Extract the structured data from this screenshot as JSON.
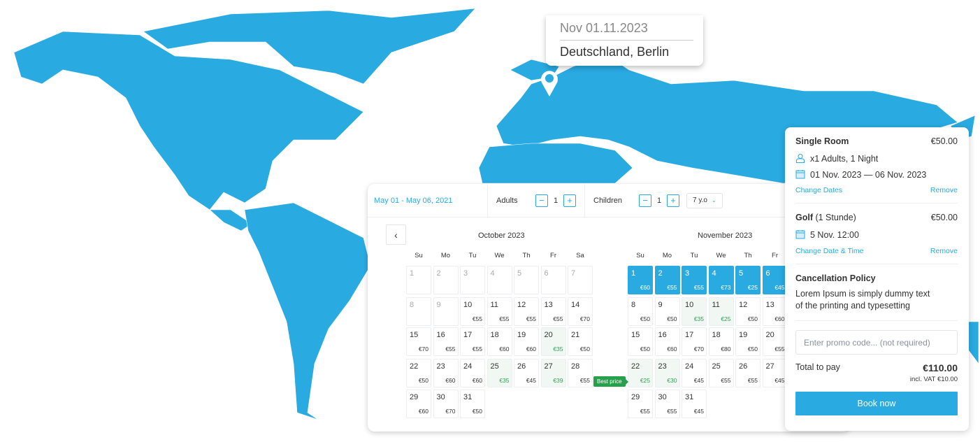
{
  "colors": {
    "accent": "#29abe2",
    "map": "#29abe2",
    "best": "#27a04c"
  },
  "tooltip": {
    "date": "Nov 01.11.2023",
    "place": "Deutschland, Berlin",
    "icon": "map-pin-icon"
  },
  "toolbar": {
    "range": "May 01 - May 06, 2021",
    "adults_label": "Adults",
    "adults": "1",
    "children_label": "Children",
    "children": "1",
    "age": "7 y.o",
    "minus": "−",
    "plus": "+"
  },
  "calendar": {
    "weekdays": [
      "Su",
      "Mo",
      "Tu",
      "We",
      "Th",
      "Fr",
      "Sa"
    ],
    "best_price": "Best price",
    "months": [
      {
        "title": "October 2023",
        "days": [
          [
            1,
            null,
            "d"
          ],
          [
            2,
            null,
            "d"
          ],
          [
            3,
            null,
            "d"
          ],
          [
            4,
            null,
            "d"
          ],
          [
            5,
            null,
            "d"
          ],
          [
            6,
            null,
            "d"
          ],
          [
            7,
            null,
            "d"
          ],
          [
            8,
            null,
            "d"
          ],
          [
            9,
            null,
            "d"
          ],
          [
            10,
            "€55"
          ],
          [
            11,
            "€55"
          ],
          [
            12,
            "€55"
          ],
          [
            13,
            "€55"
          ],
          [
            14,
            "€70"
          ],
          [
            15,
            "€70"
          ],
          [
            16,
            "€55"
          ],
          [
            17,
            "€55"
          ],
          [
            18,
            "€60"
          ],
          [
            19,
            "€60"
          ],
          [
            20,
            "€35",
            "g"
          ],
          [
            21,
            "€50"
          ],
          [
            22,
            "€50"
          ],
          [
            23,
            "€60"
          ],
          [
            24,
            "€60"
          ],
          [
            25,
            "€35",
            "g"
          ],
          [
            26,
            "€45"
          ],
          [
            27,
            "€39",
            "g"
          ],
          [
            28,
            "€55"
          ],
          [
            29,
            "€60"
          ],
          [
            30,
            "€70"
          ],
          [
            31,
            "€50"
          ]
        ]
      },
      {
        "title": "November 2023",
        "days": [
          [
            1,
            "€60",
            "s"
          ],
          [
            2,
            "€55",
            "s"
          ],
          [
            3,
            "€55",
            "s"
          ],
          [
            4,
            "€73",
            "s"
          ],
          [
            5,
            "€25",
            "s"
          ],
          [
            6,
            "€45",
            "s"
          ],
          null,
          [
            8,
            "€50"
          ],
          [
            9,
            "€50"
          ],
          [
            10,
            "€35",
            "g"
          ],
          [
            11,
            "€25",
            "g"
          ],
          [
            12,
            "€50"
          ],
          [
            13,
            "€60"
          ],
          null,
          [
            15,
            "€50"
          ],
          [
            16,
            "€60"
          ],
          [
            17,
            "€70"
          ],
          [
            18,
            "€80"
          ],
          [
            19,
            "€50"
          ],
          [
            20,
            "€55"
          ],
          null,
          [
            22,
            "€25",
            "g"
          ],
          [
            23,
            "€30",
            "g"
          ],
          [
            24,
            "€45"
          ],
          [
            25,
            "€55"
          ],
          [
            26,
            "€55"
          ],
          [
            27,
            "€45"
          ],
          null,
          [
            29,
            "€55"
          ],
          [
            30,
            "€55"
          ],
          [
            31,
            "€45"
          ]
        ]
      }
    ]
  },
  "booking": {
    "items": [
      {
        "title": "Single Room",
        "subtitle": "",
        "price": "€50.00",
        "guests": "x1 Adults, 1 Night",
        "dates": "01 Nov. 2023 — 06 Nov. 2023",
        "change": "Change Dates",
        "remove": "Remove"
      },
      {
        "title": "Golf",
        "subtitle": " (1 Stunde)",
        "price": "€50.00",
        "dates": "5 Nov. 12:00",
        "change": "Change Date & Time",
        "remove": "Remove"
      }
    ],
    "policy_title": "Cancellation Policy",
    "policy_text": "Lorem Ipsum is simply dummy text of the printing and typesetting",
    "promo_placeholder": "Enter promo code... (not required)",
    "total_label": "Total to pay",
    "total": "€110.00",
    "vat": "incl. VAT €10.00",
    "book": "Book now"
  }
}
